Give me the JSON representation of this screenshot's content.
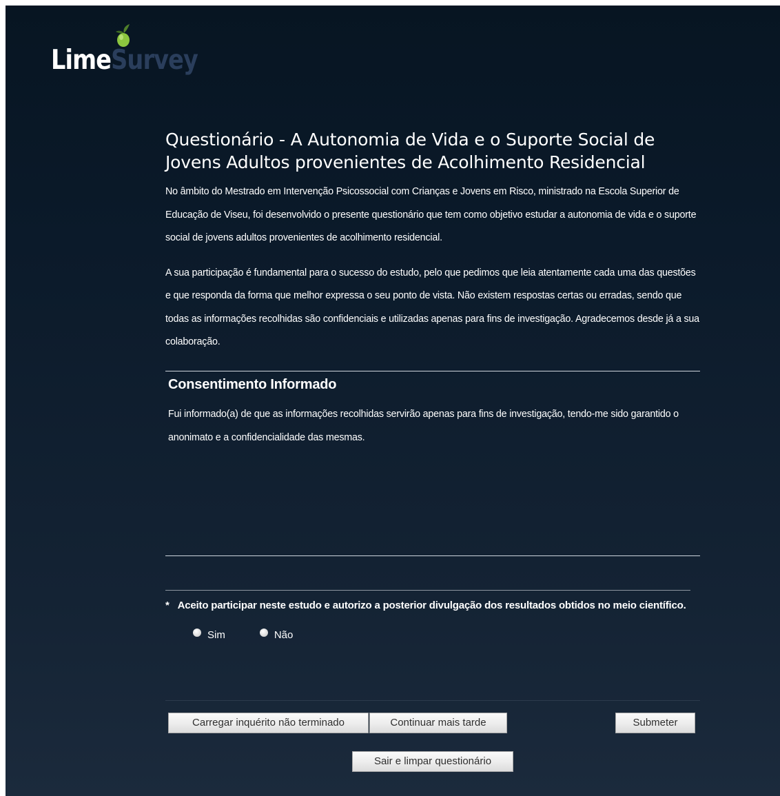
{
  "logo": {
    "part1": "Lime",
    "part2": "Survey",
    "colors": {
      "lime_text": "#ffffff",
      "survey_text": "#2a3e5c",
      "fruit": "#8cc63f"
    }
  },
  "survey": {
    "title": "Questionário - A Autonomia de Vida e o Suporte Social de Jovens Adultos provenientes de Acolhimento Residencial",
    "description": [
      "No âmbito do Mestrado em Intervenção Psicossocial com Crianças e Jovens em Risco, ministrado na Escola Superior de Educação de Viseu, foi desenvolvido o presente questionário que tem como objetivo estudar a autonomia de vida e o suporte social de jovens adultos provenientes de acolhimento residencial.",
      "A sua participação é fundamental para o sucesso do estudo, pelo que pedimos que leia atentamente cada uma das questões e que responda da forma que melhor expressa o seu ponto de vista. Não existem respostas certas ou erradas, sendo que todas as informações recolhidas são confidenciais e utilizadas apenas para fins de investigação. Agradecemos desde já a sua colaboração."
    ]
  },
  "group": {
    "title": "Consentimento Informado",
    "description": "Fui informado(a) de que as informações recolhidas servirão apenas para fins de investigação, tendo-me sido garantido o anonimato e a confidencialidade das mesmas."
  },
  "question": {
    "mandatory_mark": "*",
    "text": "Aceito participar neste estudo e autorizo a posterior divulgação dos resultados obtidos no meio científico.",
    "options": [
      {
        "label": "Sim",
        "selected": false
      },
      {
        "label": "Não",
        "selected": false
      }
    ]
  },
  "buttons": {
    "load_unfinished": "Carregar inquérito não terminado",
    "continue_later": "Continuar mais tarde",
    "submit": "Submeter",
    "exit_clear": "Sair e limpar questionário"
  }
}
